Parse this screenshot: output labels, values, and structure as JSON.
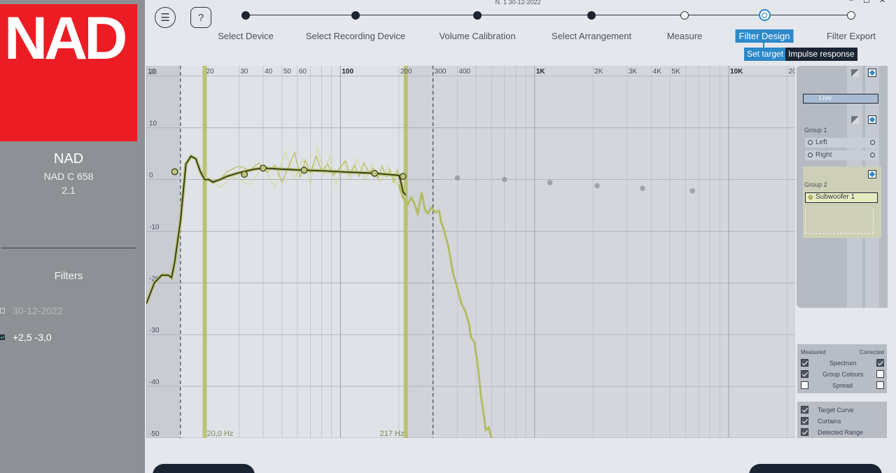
{
  "window": {
    "title_stamp": "N. 1   30-12-2022",
    "min_glyph": "–",
    "max_glyph": "☐",
    "close_glyph": "✕"
  },
  "sidebar": {
    "logo_text": "NAD",
    "brand": "NAD",
    "model": "NAD C 658",
    "config": "2.1",
    "filters_title": "Filters",
    "filters": [
      {
        "label": "30-12-2022",
        "checked": false
      },
      {
        "label": "+2,5   -3,0",
        "checked": true
      }
    ]
  },
  "toolbar": {
    "menu_glyph": "☰",
    "help_glyph": "?"
  },
  "steps": [
    {
      "label": "Select Device",
      "state": "done"
    },
    {
      "label": "Select Recording Device",
      "state": "done"
    },
    {
      "label": "Volume Calibration",
      "state": "done"
    },
    {
      "label": "Select Arrangement",
      "state": "done"
    },
    {
      "label": "Measure",
      "state": "open"
    },
    {
      "label": "Filter Design",
      "state": "active"
    },
    {
      "label": "Filter Export",
      "state": "open"
    }
  ],
  "subtabs": {
    "set_target": "Set target",
    "impulse_response": "Impulse response"
  },
  "graph": {
    "x_ticks": [
      {
        "f": 10,
        "label": "10",
        "bold": false
      },
      {
        "f": 20,
        "label": "20",
        "bold": false
      },
      {
        "f": 30,
        "label": "30",
        "bold": false
      },
      {
        "f": 40,
        "label": "40",
        "bold": false
      },
      {
        "f": 50,
        "label": "50",
        "bold": false
      },
      {
        "f": 60,
        "label": "60",
        "bold": false
      },
      {
        "f": 100,
        "label": "100",
        "bold": true
      },
      {
        "f": 200,
        "label": "200",
        "bold": false
      },
      {
        "f": 300,
        "label": "300",
        "bold": false
      },
      {
        "f": 400,
        "label": "400",
        "bold": false
      },
      {
        "f": 1000,
        "label": "1K",
        "bold": true
      },
      {
        "f": 2000,
        "label": "2K",
        "bold": false
      },
      {
        "f": 3000,
        "label": "3K",
        "bold": false
      },
      {
        "f": 4000,
        "label": "4K",
        "bold": false
      },
      {
        "f": 5000,
        "label": "5K",
        "bold": false
      },
      {
        "f": 10000,
        "label": "10K",
        "bold": true
      },
      {
        "f": 20000,
        "label": "20K",
        "bold": false
      }
    ],
    "y_ticks": [
      20,
      10,
      0,
      -10,
      -20,
      -30,
      -40,
      -50
    ],
    "y_range": [
      -50,
      22
    ],
    "x_range": [
      10,
      22000
    ],
    "detected_range_hz": [
      20,
      217
    ],
    "curtain_hz": [
      15,
      300
    ],
    "range_labels": [
      "20,0 Hz",
      "217 Hz"
    ],
    "target_points": [
      [
        14,
        1.5
      ],
      [
        32,
        1.0
      ],
      [
        40,
        2.2
      ],
      [
        65,
        1.8
      ],
      [
        150,
        1.2
      ],
      [
        210,
        0.6
      ]
    ],
    "disabled_points": [
      [
        400,
        0.3
      ],
      [
        700,
        0
      ],
      [
        1200,
        -0.6
      ],
      [
        2100,
        -1.2
      ],
      [
        3600,
        -1.7
      ],
      [
        6500,
        -2.2
      ]
    ],
    "corrected_curve": [
      [
        10,
        -24
      ],
      [
        11,
        -20
      ],
      [
        12,
        -18.5
      ],
      [
        13,
        -18.5
      ],
      [
        13.5,
        -19
      ],
      [
        14,
        -16
      ],
      [
        15,
        -8
      ],
      [
        16,
        3
      ],
      [
        17,
        4.5
      ],
      [
        18,
        4
      ],
      [
        19,
        1.5
      ],
      [
        20,
        0
      ],
      [
        21,
        0
      ],
      [
        22,
        -0.5
      ],
      [
        24,
        0
      ],
      [
        26,
        0.6
      ],
      [
        30,
        1.3
      ],
      [
        36,
        2
      ],
      [
        40,
        2.2
      ],
      [
        50,
        2
      ],
      [
        65,
        1.8
      ],
      [
        80,
        1.7
      ],
      [
        100,
        1.5
      ],
      [
        150,
        1.2
      ],
      [
        200,
        0.8
      ],
      [
        205,
        -0.5
      ],
      [
        210,
        -2.4
      ],
      [
        217,
        -3
      ]
    ],
    "measured_wavy": [
      [
        24,
        0
      ],
      [
        26,
        1.5
      ],
      [
        30,
        2.6
      ],
      [
        34,
        1.8
      ],
      [
        38,
        3.2
      ],
      [
        42,
        1.4
      ],
      [
        46,
        2.8
      ],
      [
        50,
        -0.5
      ],
      [
        54,
        2.4
      ],
      [
        58,
        5.2
      ],
      [
        62,
        0.5
      ],
      [
        66,
        3.8
      ],
      [
        70,
        1.2
      ],
      [
        75,
        4.5
      ],
      [
        80,
        1.6
      ],
      [
        86,
        3.0
      ],
      [
        92,
        0.8
      ],
      [
        100,
        2.4
      ],
      [
        106,
        3.6
      ],
      [
        112,
        1.0
      ],
      [
        118,
        2.8
      ],
      [
        125,
        0.6
      ],
      [
        132,
        3.2
      ],
      [
        140,
        1.4
      ],
      [
        148,
        2.2
      ],
      [
        156,
        0.2
      ],
      [
        164,
        2.6
      ],
      [
        172,
        0.5
      ],
      [
        180,
        2.0
      ],
      [
        188,
        -0.6
      ],
      [
        196,
        1.8
      ],
      [
        205,
        0.4
      ]
    ],
    "measured_thin": [
      [
        20,
        0.5
      ],
      [
        24,
        -1.5
      ],
      [
        28,
        0.5
      ],
      [
        34,
        -1
      ],
      [
        40,
        2.5
      ],
      [
        46,
        -1.5
      ],
      [
        52,
        5.5
      ],
      [
        58,
        0
      ],
      [
        64,
        4
      ],
      [
        70,
        -1
      ],
      [
        76,
        6.5
      ],
      [
        82,
        1
      ],
      [
        88,
        4.5
      ],
      [
        95,
        -1
      ],
      [
        104,
        3.5
      ],
      [
        112,
        0
      ],
      [
        122,
        4
      ],
      [
        134,
        0
      ],
      [
        146,
        3
      ],
      [
        160,
        -0.5
      ],
      [
        176,
        2.5
      ],
      [
        194,
        -1
      ],
      [
        210,
        1
      ]
    ],
    "measured_drop": [
      [
        200,
        -1
      ],
      [
        210,
        -3.5
      ],
      [
        222,
        -4.8
      ],
      [
        232,
        -3.5
      ],
      [
        240,
        -4.6
      ],
      [
        250,
        -6.6
      ],
      [
        262,
        -2.5
      ],
      [
        272,
        -5.8
      ],
      [
        282,
        -6.6
      ],
      [
        294,
        -5.4
      ],
      [
        310,
        -6.4
      ],
      [
        322,
        -6
      ],
      [
        330,
        -8.2
      ],
      [
        340,
        -9.5
      ],
      [
        360,
        -13
      ],
      [
        380,
        -18
      ],
      [
        400,
        -21
      ],
      [
        420,
        -24
      ],
      [
        440,
        -25.5
      ],
      [
        460,
        -28
      ],
      [
        470,
        -30.5
      ],
      [
        490,
        -31.5
      ],
      [
        510,
        -36
      ],
      [
        530,
        -42
      ],
      [
        550,
        -46
      ],
      [
        560,
        -48.5
      ],
      [
        580,
        -48
      ],
      [
        600,
        -50
      ]
    ]
  },
  "groups": {
    "live_label": "Live",
    "group_1_label": "Group 1",
    "group_1_items": [
      "Left",
      "Right"
    ],
    "group_2_label": "Group 2",
    "group_2_items": [
      "Subwoofer 1"
    ]
  },
  "display_options": {
    "measured": "Measured",
    "corrected": "Corrected",
    "rows": [
      {
        "label": "Spectrum",
        "measured": true,
        "corrected": true
      },
      {
        "label": "Group Colours",
        "measured": true,
        "corrected": false
      },
      {
        "label": "Spread",
        "measured": false,
        "corrected": false
      }
    ]
  },
  "curve_options": [
    {
      "label": "Target Curve",
      "checked": true
    },
    {
      "label": "Curtains",
      "checked": true
    },
    {
      "label": "Detected Range",
      "checked": true
    }
  ],
  "colors": {
    "accent": "#2d89c8",
    "brand_red": "#ec1c24",
    "curve": "#b3bd64",
    "target": "#2a2f1b"
  }
}
